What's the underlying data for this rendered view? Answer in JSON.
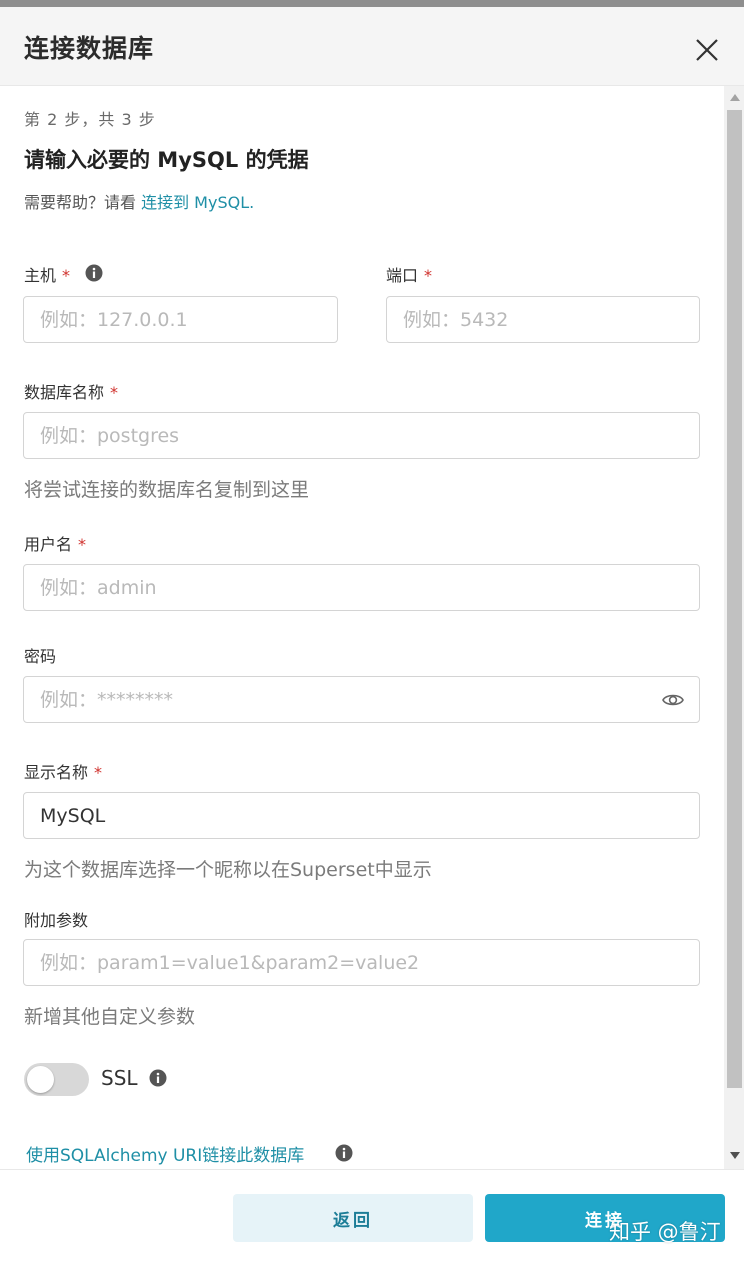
{
  "modal": {
    "title": "连接数据库",
    "step": "第 2 步，共 3 步",
    "subtitle": "请输入必要的 MySQL 的凭据",
    "help_prefix": "需要帮助？请看 ",
    "help_link": "连接到 MySQL."
  },
  "fields": {
    "host": {
      "label": "主机",
      "required": "*",
      "placeholder": "例如：127.0.0.1",
      "value": ""
    },
    "port": {
      "label": "端口",
      "required": "*",
      "placeholder": "例如：5432",
      "value": ""
    },
    "database": {
      "label": "数据库名称",
      "required": "*",
      "placeholder": "例如：postgres",
      "value": "",
      "hint": "将尝试连接的数据库名复制到这里"
    },
    "username": {
      "label": "用户名",
      "required": "*",
      "placeholder": "例如：admin",
      "value": ""
    },
    "password": {
      "label": "密码",
      "placeholder": "例如：********",
      "value": ""
    },
    "display_name": {
      "label": "显示名称",
      "required": "*",
      "placeholder": "",
      "value": "MySQL",
      "hint": "为这个数据库选择一个昵称以在Superset中显示"
    },
    "extra": {
      "label": "附加参数",
      "placeholder": "例如：param1=value1&param2=value2",
      "value": "",
      "hint": "新增其他自定义参数"
    }
  },
  "ssl": {
    "label": "SSL",
    "enabled": false
  },
  "uri_link": "使用SQLAlchemy URI链接此数据库",
  "buttons": {
    "back": "返回",
    "connect": "连接"
  },
  "watermark": "知乎 @鲁汀",
  "icons": {
    "close": "close-icon",
    "info": "info-icon",
    "eye": "eye-icon"
  },
  "colors": {
    "accent": "#20a7c9",
    "link": "#1f8fa6",
    "required": "#d0312d"
  }
}
